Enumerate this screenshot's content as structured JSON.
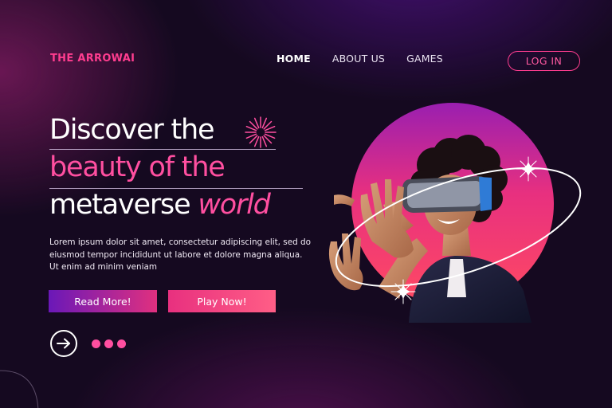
{
  "brand": {
    "name": "THE ARROWAI"
  },
  "nav": {
    "items": [
      {
        "label": "HOME",
        "active": true
      },
      {
        "label": "ABOUT US",
        "active": false
      },
      {
        "label": "GAMES",
        "active": false
      }
    ],
    "login_label": "LOG IN"
  },
  "hero": {
    "headline": {
      "line1": "Discover the",
      "line2": "beauty of the",
      "line3_main": "metaverse ",
      "line3_accent": "world"
    },
    "body": "Lorem ipsum dolor sit amet, consectetur adipiscing elit, sed do eiusmod tempor incididunt ut labore et dolore magna aliqua. Ut enim ad minim veniam",
    "buttons": {
      "read_more": "Read More!",
      "play_now": "Play Now!"
    },
    "image_icon": "vr-headset-person-icon"
  },
  "carousel": {
    "dot_count": 3,
    "active_dot": 1
  },
  "colors": {
    "background": "#150920",
    "accent_pink": "#ff3d8f",
    "accent_purple": "#6a18b8",
    "text_light": "#ffffff"
  }
}
